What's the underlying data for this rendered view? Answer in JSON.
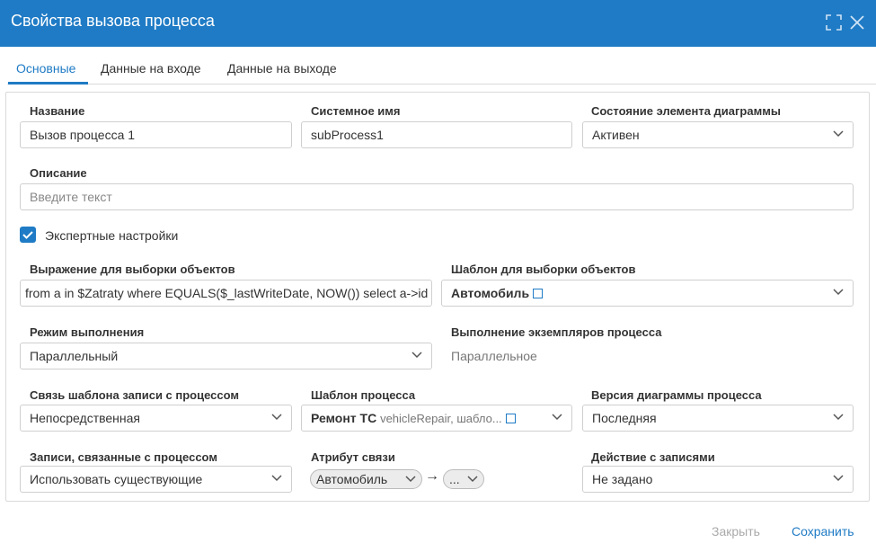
{
  "dialog": {
    "title": "Свойства вызова процесса"
  },
  "tabs": [
    {
      "label": "Основные"
    },
    {
      "label": "Данные на входе"
    },
    {
      "label": "Данные на выходе"
    }
  ],
  "fields": {
    "name": {
      "label": "Название",
      "value": "Вызов процесса 1"
    },
    "system_name": {
      "label": "Системное имя",
      "value": "subProcess1"
    },
    "state": {
      "label": "Состояние элемента диаграммы",
      "value": "Активен"
    },
    "description": {
      "label": "Описание",
      "placeholder": "Введите текст"
    },
    "expert": {
      "label": "Экспертные настройки",
      "checked": true
    },
    "selection_expr": {
      "label": "Выражение для выборки объектов",
      "value": "from a in $Zatraty where EQUALS($_lastWriteDate, NOW()) select a->id"
    },
    "selection_template": {
      "label": "Шаблон для выборки объектов",
      "value": "Автомобиль"
    },
    "exec_mode": {
      "label": "Режим выполнения",
      "value": "Параллельный"
    },
    "instances_exec": {
      "label": "Выполнение экземпляров процесса",
      "value": "Параллельное"
    },
    "record_link": {
      "label": "Связь шаблона записи с процессом",
      "value": "Непосредственная"
    },
    "process_template": {
      "label": "Шаблон процесса",
      "value": "Ремонт ТС",
      "secondary": "vehicleRepair, шабло..."
    },
    "diagram_version": {
      "label": "Версия диаграммы процесса",
      "value": "Последняя"
    },
    "related_records": {
      "label": "Записи, связанные с процессом",
      "value": "Использовать существующие"
    },
    "link_attribute": {
      "label": "Атрибут связи",
      "source": "Автомобиль",
      "target": "..."
    },
    "records_action": {
      "label": "Действие с записями",
      "value": "Не задано"
    }
  },
  "footer": {
    "close_label": "Закрыть",
    "save_label": "Сохранить"
  },
  "colors": {
    "accent": "#1f7bc5",
    "disabled": "#aaaaaa"
  }
}
